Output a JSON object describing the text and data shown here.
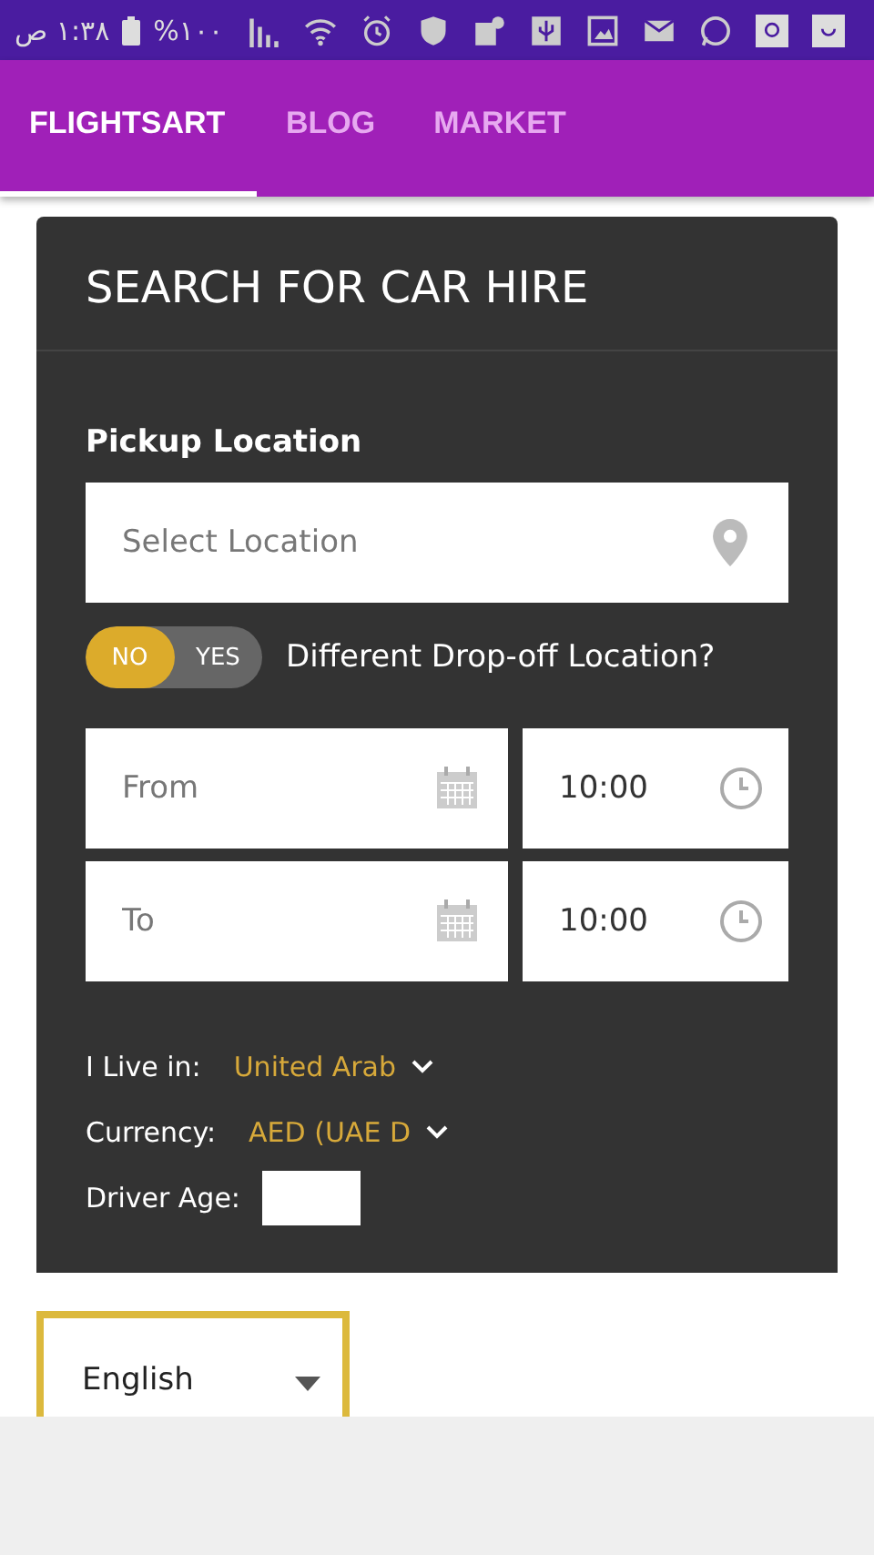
{
  "status_bar": {
    "time": "١:٣٨ ص",
    "battery": "%١٠٠"
  },
  "tabs": [
    {
      "label": "FLIGHTSART",
      "selected": true
    },
    {
      "label": "BLOG",
      "selected": false
    },
    {
      "label": "MARKET",
      "selected": false
    }
  ],
  "card": {
    "title": "SEARCH FOR CAR HIRE",
    "pickup_label": "Pickup Location",
    "pickup_placeholder": "Select Location",
    "dropoff_toggle": [
      {
        "label": "NO",
        "selected": true
      },
      {
        "label": "YES",
        "selected": false
      }
    ],
    "dropoff_label": "Different Drop-off Location?",
    "dates": [
      {
        "placeholder": "From",
        "time": "10:00"
      },
      {
        "placeholder": "To",
        "time": "10:00"
      }
    ],
    "options": [
      {
        "label": "I Live in:",
        "value": "United Arab"
      },
      {
        "label": "Currency:",
        "value": "AED (UAE D"
      }
    ],
    "driver_age_label": "Driver Age:"
  },
  "language": {
    "value": "English"
  }
}
